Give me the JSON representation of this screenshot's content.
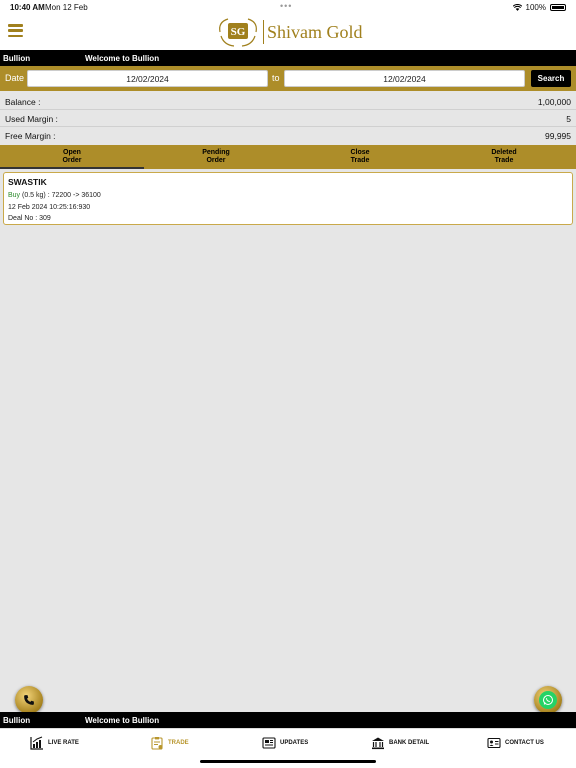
{
  "status_bar": {
    "time": "10:40 AM",
    "date": "Mon 12 Feb",
    "battery": "100%"
  },
  "header": {
    "brand": "Shivam Gold"
  },
  "title_bar": {
    "left": "Bullion",
    "right": "Welcome to Bullion"
  },
  "date_filter": {
    "label": "Date",
    "from": "12/02/2024",
    "to_label": "to",
    "to": "12/02/2024",
    "search_label": "Search"
  },
  "account": [
    {
      "label": "Balance :",
      "value": "1,00,000"
    },
    {
      "label": "Used Margin :",
      "value": "5"
    },
    {
      "label": "Free Margin :",
      "value": "99,995"
    }
  ],
  "tabs": [
    {
      "line1": "Open",
      "line2": "Order"
    },
    {
      "line1": "Pending",
      "line2": "Order"
    },
    {
      "line1": "Close",
      "line2": "Trade"
    },
    {
      "line1": "Deleted",
      "line2": "Trade"
    }
  ],
  "order": {
    "symbol": "SWASTIK",
    "side": "Buy",
    "detail": "(0.5 kg) : 72200 -> 36100",
    "timestamp": "12 Feb 2024 10:25:16:930",
    "deal": "Deal No : 309"
  },
  "footer_bar": {
    "left": "Bullion",
    "right": "Welcome to Bullion"
  },
  "bottom_nav": [
    {
      "label": "LIVE RATE",
      "icon": "chart-icon"
    },
    {
      "label": "TRADE",
      "icon": "clipboard-icon"
    },
    {
      "label": "UPDATES",
      "icon": "newspaper-icon"
    },
    {
      "label": "BANK DETAIL",
      "icon": "bank-icon"
    },
    {
      "label": "CONTACT US",
      "icon": "contact-card-icon"
    }
  ],
  "colors": {
    "gold": "#ad8d29",
    "buy": "#2a8a2a",
    "active_nav": "#b8962d"
  }
}
